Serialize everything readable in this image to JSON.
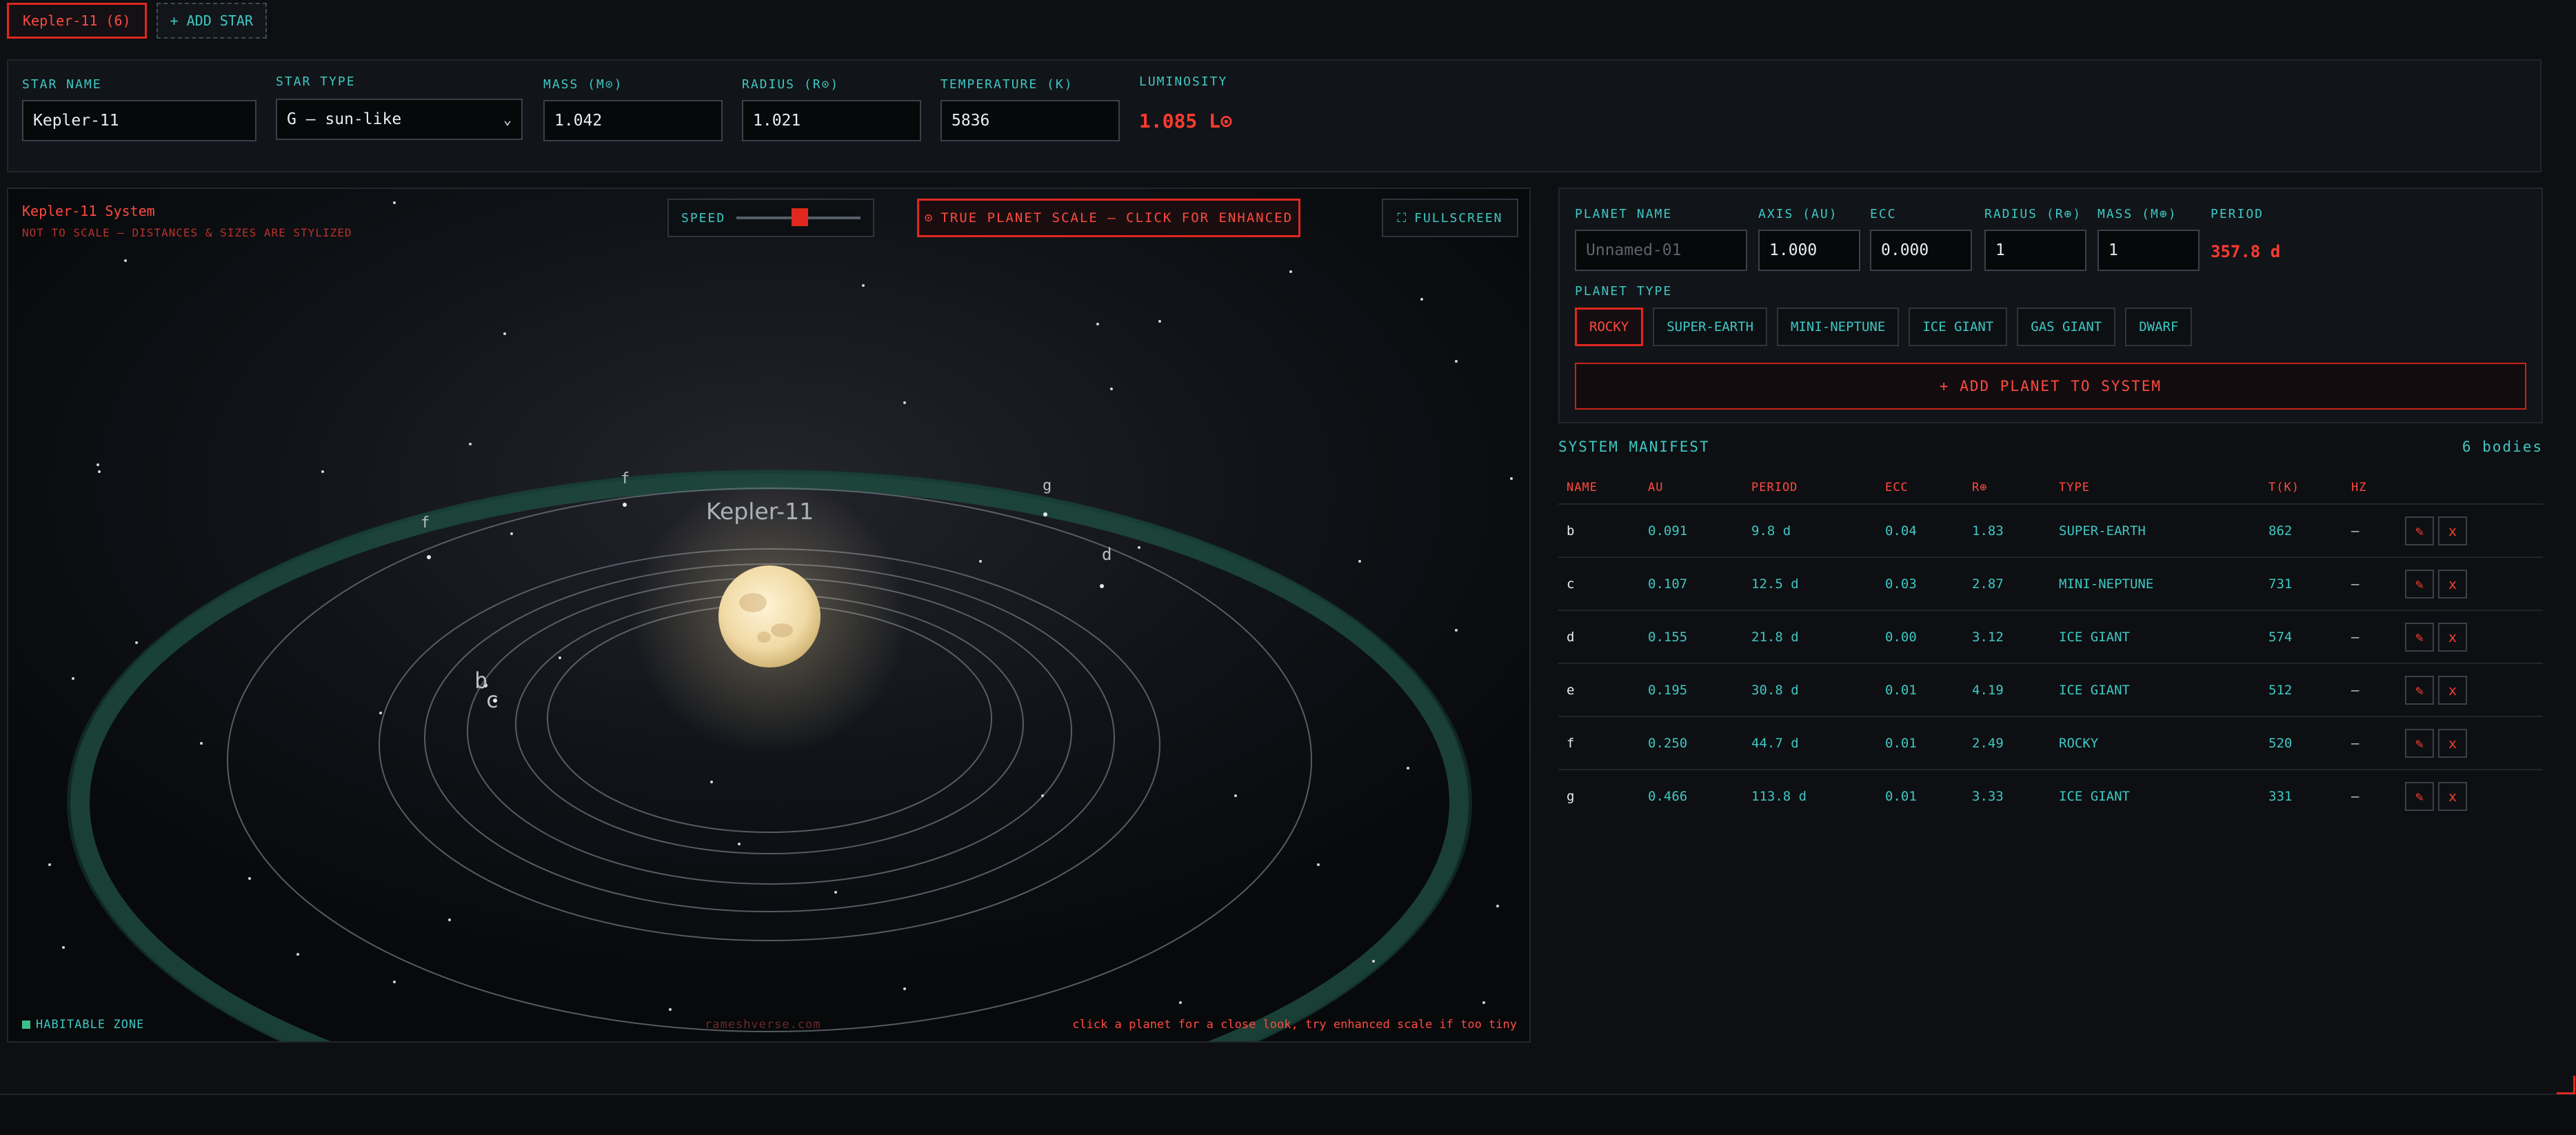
{
  "tabs": {
    "star_tab": "Kepler-11 (6)",
    "add_star": "+ ADD STAR"
  },
  "star": {
    "name_label": "STAR NAME",
    "name_value": "Kepler-11",
    "type_label": "STAR TYPE",
    "type_value": "G — sun-like",
    "mass_label": "MASS (M⊙)",
    "mass_value": "1.042",
    "radius_label": "RADIUS (R⊙)",
    "radius_value": "1.021",
    "temp_label": "TEMPERATURE (K)",
    "temp_value": "5836",
    "lum_label": "LUMINOSITY",
    "lum_value": "1.085 L⊙"
  },
  "sim": {
    "title": "Kepler-11 System",
    "subtitle": "NOT TO SCALE — DISTANCES & SIZES ARE STYLIZED",
    "speed_label": "SPEED",
    "scale_button": "TRUE PLANET SCALE — CLICK FOR ENHANCED",
    "fullscreen": "FULLSCREEN",
    "star_label": "Kepler-11",
    "habitable_zone": "HABITABLE ZONE",
    "credit": "rameshverse.com",
    "hint": "click a planet for a close look, try enhanced scale if too tiny",
    "planet_labels": [
      "b",
      "c",
      "d",
      "e",
      "f",
      "g"
    ],
    "colors": {
      "star": "#f2dfae",
      "habitable_zone": "#1d4a3e"
    }
  },
  "planet_form": {
    "name_label": "PLANET NAME",
    "name_placeholder": "Unnamed-01",
    "axis_label": "AXIS (AU)",
    "axis_value": "1.000",
    "ecc_label": "ECC",
    "ecc_value": "0.000",
    "radius_label": "RADIUS (R⊕)",
    "radius_value": "1",
    "mass_label": "MASS (M⊕)",
    "mass_value": "1",
    "period_label": "PERIOD",
    "period_value": "357.8 d",
    "type_label": "PLANET TYPE",
    "types": [
      "ROCKY",
      "SUPER-EARTH",
      "MINI-NEPTUNE",
      "ICE GIANT",
      "GAS GIANT",
      "DWARF"
    ],
    "add_button": "+ ADD PLANET TO SYSTEM"
  },
  "manifest": {
    "title": "SYSTEM MANIFEST",
    "count": "6 bodies",
    "headers": {
      "name": "NAME",
      "au": "AU",
      "period": "PERIOD",
      "ecc": "ECC",
      "r": "R⊕",
      "type": "TYPE",
      "t": "T(K)",
      "hz": "HZ"
    },
    "rows": [
      {
        "name": "b",
        "au": "0.091",
        "period": "9.8 d",
        "ecc": "0.04",
        "r": "1.83",
        "type": "SUPER-EARTH",
        "t": "862",
        "hz": "—"
      },
      {
        "name": "c",
        "au": "0.107",
        "period": "12.5 d",
        "ecc": "0.03",
        "r": "2.87",
        "type": "MINI-NEPTUNE",
        "t": "731",
        "hz": "—"
      },
      {
        "name": "d",
        "au": "0.155",
        "period": "21.8 d",
        "ecc": "0.00",
        "r": "3.12",
        "type": "ICE GIANT",
        "t": "574",
        "hz": "—"
      },
      {
        "name": "e",
        "au": "0.195",
        "period": "30.8 d",
        "ecc": "0.01",
        "r": "4.19",
        "type": "ICE GIANT",
        "t": "512",
        "hz": "—"
      },
      {
        "name": "f",
        "au": "0.250",
        "period": "44.7 d",
        "ecc": "0.01",
        "r": "2.49",
        "type": "ROCKY",
        "t": "520",
        "hz": "—"
      },
      {
        "name": "g",
        "au": "0.466",
        "period": "113.8 d",
        "ecc": "0.01",
        "r": "3.33",
        "type": "ICE GIANT",
        "t": "331",
        "hz": "—"
      }
    ],
    "edit_icon": "✎",
    "delete_icon": "x"
  }
}
